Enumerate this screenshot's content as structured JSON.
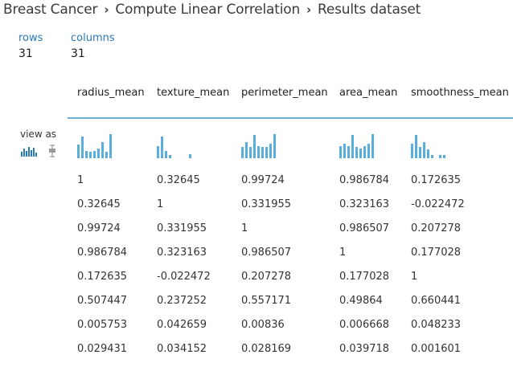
{
  "breadcrumb": {
    "items": [
      "Breast Cancer",
      "Compute Linear Correlation",
      "Results dataset"
    ],
    "separator": "›"
  },
  "stats": {
    "rows_label": "rows",
    "rows_value": "31",
    "columns_label": "columns",
    "columns_value": "31"
  },
  "view_as": {
    "label": "view as",
    "modes": [
      "histogram-icon",
      "boxplot-icon"
    ]
  },
  "table": {
    "columns": [
      "radius_mean",
      "texture_mean",
      "perimeter_mean",
      "area_mean",
      "smoothness_mean"
    ],
    "rows": [
      [
        "1",
        "0.32645",
        "0.99724",
        "0.986784",
        "0.172635"
      ],
      [
        "0.32645",
        "1",
        "0.331955",
        "0.323163",
        "-0.022472"
      ],
      [
        "0.99724",
        "0.331955",
        "1",
        "0.986507",
        "0.207278"
      ],
      [
        "0.986784",
        "0.323163",
        "0.986507",
        "1",
        "0.177028"
      ],
      [
        "0.172635",
        "-0.022472",
        "0.207278",
        "0.177028",
        "1"
      ],
      [
        "0.507447",
        "0.237252",
        "0.557171",
        "0.49864",
        "0.660441"
      ],
      [
        "0.005753",
        "0.042659",
        "0.00836",
        "0.006668",
        "0.048233"
      ],
      [
        "0.029431",
        "0.034152",
        "0.028169",
        "0.039718",
        "0.001601"
      ]
    ],
    "histograms": [
      [
        0.55,
        0.9,
        0.3,
        0.28,
        0.3,
        0.4,
        0.65,
        0.25,
        1.0
      ],
      [
        0.5,
        0.9,
        0.3,
        0.12,
        0,
        0,
        0,
        0,
        0.15
      ],
      [
        0.45,
        0.65,
        0.45,
        0.95,
        0.5,
        0.45,
        0.45,
        0.6,
        1.0
      ],
      [
        0.5,
        0.6,
        0.5,
        0.95,
        0.45,
        0.4,
        0.5,
        0.6,
        1.0
      ],
      [
        0.6,
        0.95,
        0.45,
        0.65,
        0.35,
        0.12,
        0,
        0.12,
        0.12
      ]
    ]
  },
  "colors": {
    "accent": "#2a7ab8",
    "bar": "#5aaede",
    "rule": "#6ab0d8",
    "text": "#333333"
  }
}
